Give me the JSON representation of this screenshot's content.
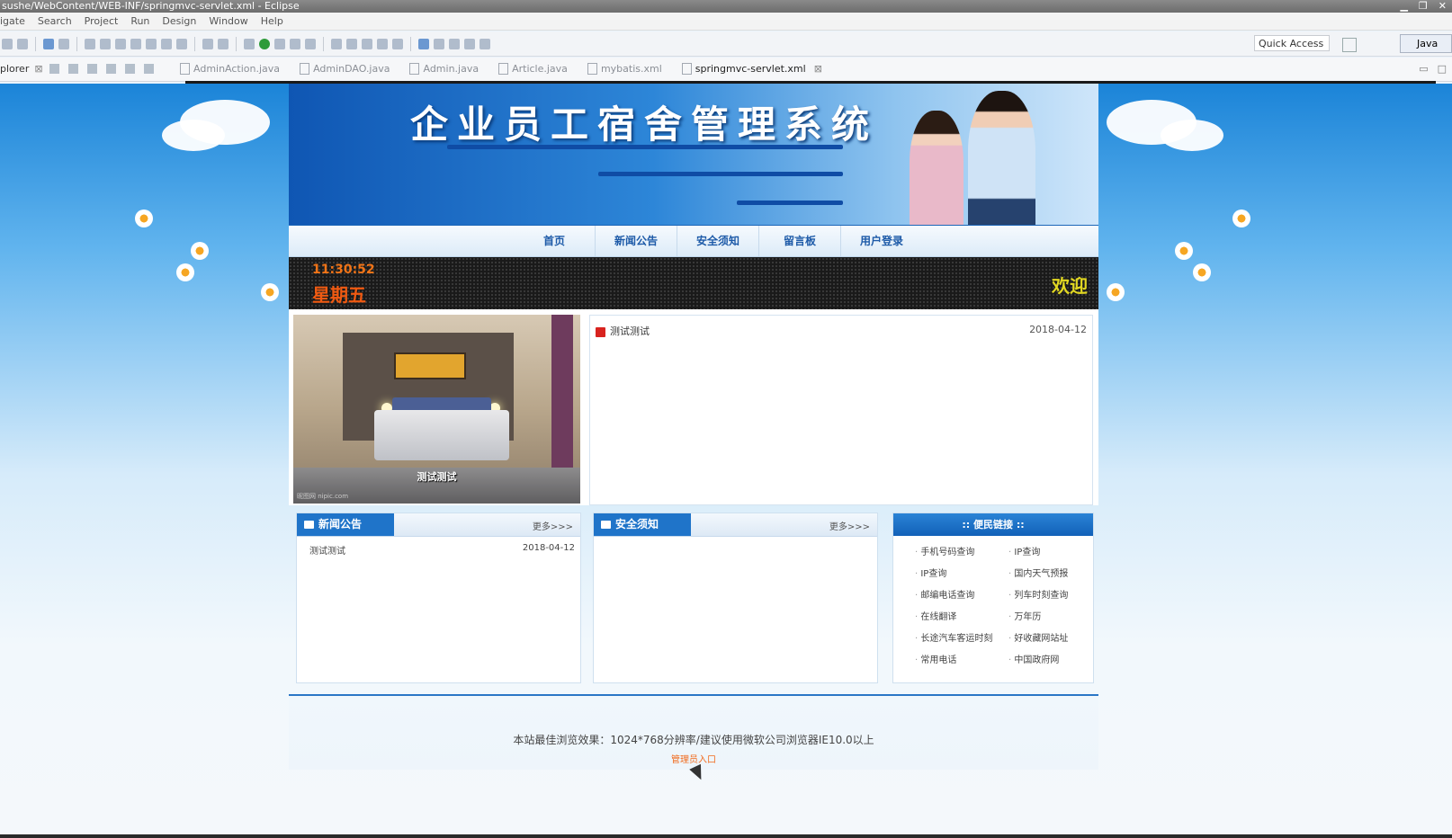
{
  "window": {
    "title": "sushe/WebContent/WEB-INF/springmvc-servlet.xml - Eclipse"
  },
  "menu": [
    "igate",
    "Search",
    "Project",
    "Run",
    "Design",
    "Window",
    "Help"
  ],
  "toolbar": {
    "quick_access": "Quick Access",
    "perspective": "Java EE"
  },
  "explorer_tab": "plorer",
  "editor_tabs": [
    {
      "label": "AdminAction.java",
      "active": false
    },
    {
      "label": "AdminDAO.java",
      "active": false
    },
    {
      "label": "Admin.java",
      "active": false
    },
    {
      "label": "Article.java",
      "active": false
    },
    {
      "label": "mybatis.xml",
      "active": false
    },
    {
      "label": "springmvc-servlet.xml",
      "active": true
    }
  ],
  "site": {
    "title": "企业员工宿舍管理系统",
    "nav": [
      "首页",
      "新闻公告",
      "安全须知",
      "留言板",
      "用户登录"
    ],
    "ticker": {
      "time": "11:30:52",
      "weekday": "星期五",
      "welcome": "欢迎"
    },
    "feature": {
      "image_caption": "测试测试",
      "watermark": "昵图网 nipic.com",
      "latest": {
        "title": "测试测试",
        "date": "2018-04-12"
      }
    },
    "news_box": {
      "title": "新闻公告",
      "more": "更多>>>",
      "items": [
        {
          "title": "测试测试",
          "date": "2018-04-12"
        }
      ]
    },
    "safety_box": {
      "title": "安全须知",
      "more": "更多>>>"
    },
    "links_box": {
      "title": ":: 便民链接 ::",
      "items": [
        "手机号码查询",
        "IP查询",
        "IP查询",
        "国内天气预报",
        "邮编电话查询",
        "列车时刻查询",
        "在线翻译",
        "万年历",
        "长途汽车客运时刻",
        "好收藏网站址",
        "常用电话",
        "中国政府网"
      ]
    },
    "footer": {
      "text": "本站最佳浏览效果：1024*768分辨率/建议使用微软公司浏览器IE10.0以上",
      "admin_link": "管理员入口"
    }
  },
  "colors": {
    "accent": "#1f74c9",
    "orange": "#f06a1c",
    "welcome": "#e2d822"
  }
}
